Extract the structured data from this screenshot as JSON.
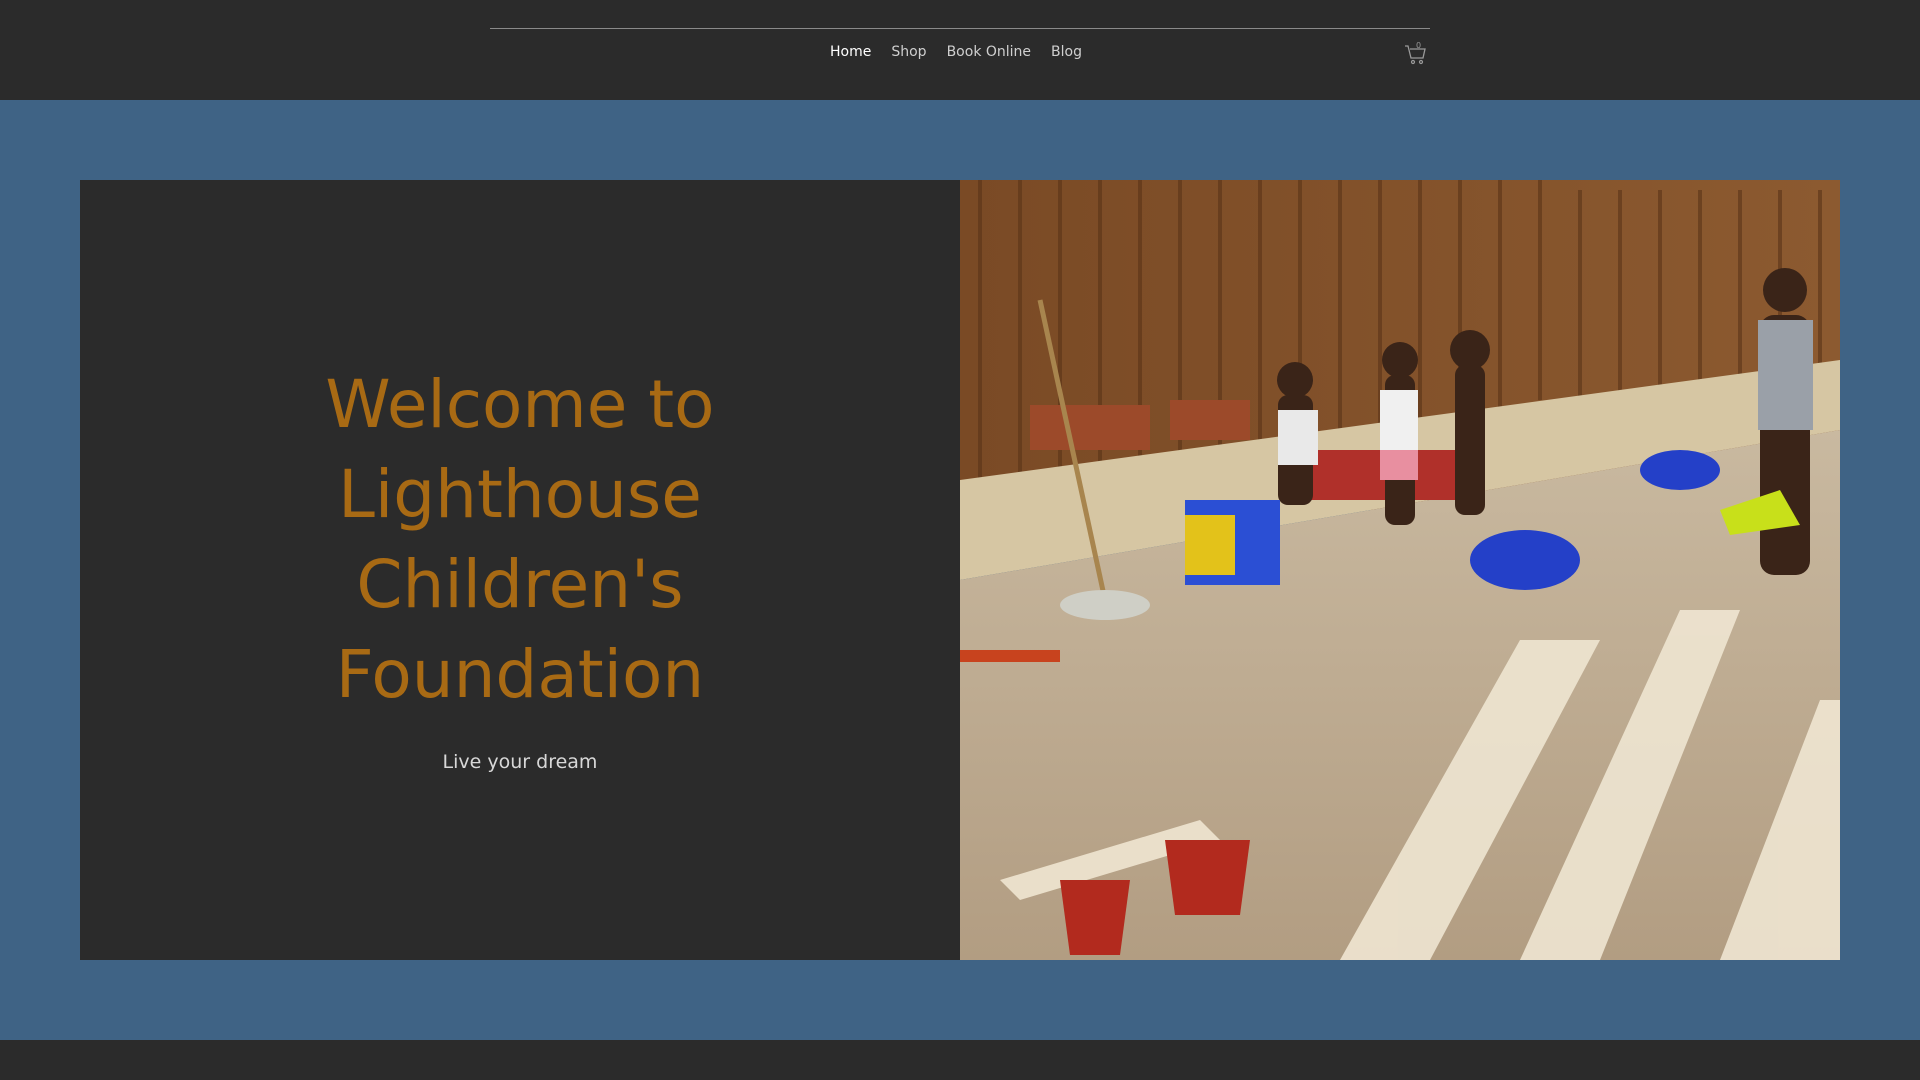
{
  "nav": {
    "items": [
      {
        "label": "Home",
        "active": true
      },
      {
        "label": "Shop",
        "active": false
      },
      {
        "label": "Book Online",
        "active": false
      },
      {
        "label": "Blog",
        "active": false
      }
    ],
    "cart_count": "0",
    "cart_icon": "cart-icon"
  },
  "hero": {
    "title_lines": [
      "Welcome to",
      "Lighthouse",
      "Children's",
      "Foundation"
    ],
    "subtitle": "Live your dream",
    "image": "photo-children-playing-on-patio"
  },
  "colors": {
    "header_bg": "#2b2b2b",
    "page_bg": "#3f6385",
    "title": "#a86a14"
  }
}
